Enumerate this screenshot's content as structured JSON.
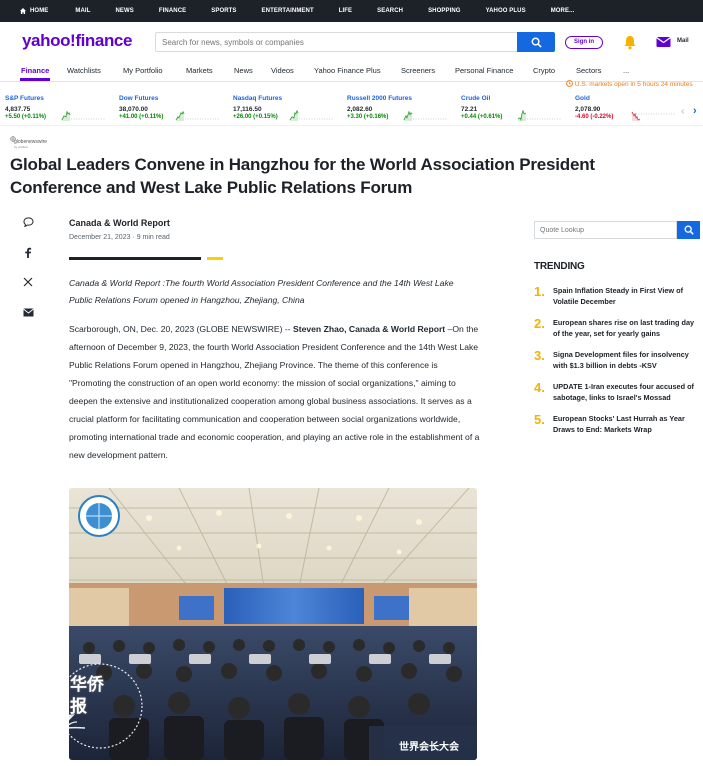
{
  "topbar": {
    "items": [
      "HOME",
      "MAIL",
      "NEWS",
      "FINANCE",
      "SPORTS",
      "ENTERTAINMENT",
      "LIFE",
      "SEARCH",
      "SHOPPING",
      "YAHOO PLUS",
      "MORE..."
    ]
  },
  "header": {
    "logo_yahoo": "yahoo!",
    "logo_finance": "finance",
    "search_placeholder": "Search for news, symbols or companies",
    "signin": "Sign in",
    "mail": "Mail"
  },
  "nav": {
    "items": [
      "Finance",
      "Watchlists",
      "My Portfolio",
      "Markets",
      "News",
      "Videos",
      "Yahoo Finance Plus",
      "Screeners",
      "Personal Finance",
      "Crypto",
      "Sectors",
      "..."
    ],
    "active_item": "Finance",
    "market_status": "U.S. markets open in 5 hours 24 minutes"
  },
  "tickers": [
    {
      "name": "S&P Futures",
      "value": "4,837.75",
      "change": "+5.50 (+0.11%)",
      "direction": "up"
    },
    {
      "name": "Dow Futures",
      "value": "38,070.00",
      "change": "+41.00 (+0.11%)",
      "direction": "up"
    },
    {
      "name": "Nasdaq Futures",
      "value": "17,116.50",
      "change": "+26.00 (+0.15%)",
      "direction": "up"
    },
    {
      "name": "Russell 2000 Futures",
      "value": "2,082.60",
      "change": "+3.30 (+0.16%)",
      "direction": "up"
    },
    {
      "name": "Crude Oil",
      "value": "72.21",
      "change": "+0.44 (+0.61%)",
      "direction": "up"
    },
    {
      "name": "Gold",
      "value": "2,078.90",
      "change": "-4.60 (-0.22%)",
      "direction": "down"
    }
  ],
  "article": {
    "source_logo_text": "globenewswire",
    "source_logo_sub": "by notified",
    "headline": "Global Leaders Convene in Hangzhou for the World Association President Conference and West Lake Public Relations Forum",
    "author": "Canada & World Report",
    "date": "December 21, 2023 · 9 min read",
    "lead": "Canada & World Report :The fourth World Association President Conference and the 14th West Lake Public Relations Forum opened in Hangzhou, Zhejiang, China",
    "body_prefix": "Scarborough, ON, Dec. 20, 2023 (GLOBE NEWSWIRE) -- ",
    "body_bold": "Steven Zhao, Canada & World Report",
    "body_rest": " –On the afternoon of December 9, 2023, the fourth World Association President Conference and the 14th West Lake Public Relations Forum opened  in Hangzhou, Zhejiang Province. The theme of this conference is \"Promoting the construction of an open world economy: the mission of social organizations,\" aiming to deepen the extensive and institutionalized cooperation among global business associations. It serves as a crucial platform for facilitating communication and cooperation between social organizations worldwide, promoting international trade and economic cooperation, and playing an active role in the establishment of a new development pattern.",
    "photo_banner_text": "世界会长大会",
    "watermark_text": "华侨报"
  },
  "sidebar": {
    "quote_placeholder": "Quote Lookup",
    "trending_title": "TRENDING",
    "trending": [
      {
        "num": "1.",
        "text": "Spain Inflation Steady in First View of Volatile December"
      },
      {
        "num": "2.",
        "text": "European shares rise on last trading day of the year, set for yearly gains"
      },
      {
        "num": "3.",
        "text": "Signa Development files for insolvency with $1.3 billion in debts -KSV"
      },
      {
        "num": "4.",
        "text": "UPDATE 1-Iran executes four accused of sabotage, links to Israel's Mossad"
      },
      {
        "num": "5.",
        "text": "European Stocks' Last Hurrah as Year Draws to End: Markets Wrap"
      }
    ]
  },
  "colors": {
    "brand": "#6001d2",
    "accent_blue": "#1469e0",
    "up": "#008a00",
    "down": "#d60a22",
    "trending_num": "#f5b200"
  }
}
